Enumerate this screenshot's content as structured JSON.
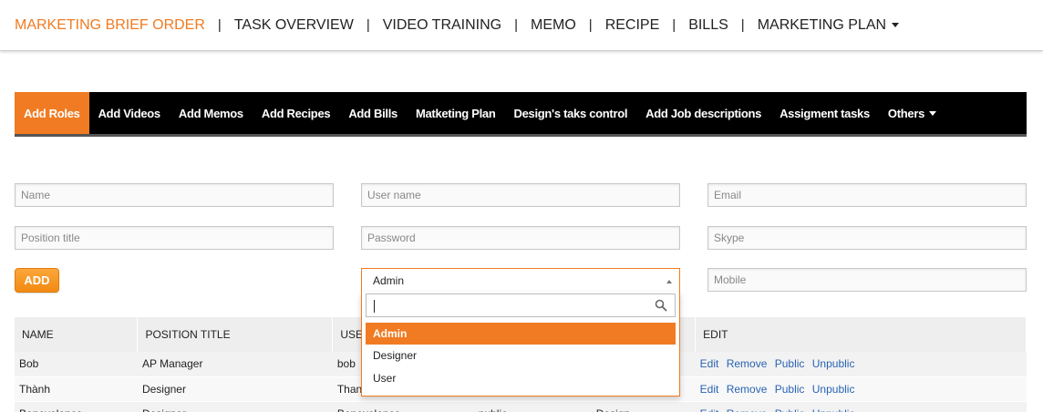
{
  "topnav": {
    "items": [
      "MARKETING BRIEF ORDER",
      "TASK OVERVIEW",
      "VIDEO TRAINING",
      "MEMO",
      "RECIPE",
      "BILLS",
      "MARKETING PLAN"
    ],
    "separator": "|",
    "active": 0
  },
  "subnav": {
    "items": [
      "Add Roles",
      "Add Videos",
      "Add Memos",
      "Add Recipes",
      "Add Bills",
      "Matketing Plan",
      "Design's taks control",
      "Add Job descriptions",
      "Assigment tasks",
      "Others"
    ],
    "active": 0
  },
  "form": {
    "name_placeholder": "Name",
    "username_placeholder": "User name",
    "email_placeholder": "Email",
    "position_placeholder": "Position title",
    "password_placeholder": "Password",
    "skype_placeholder": "Skype",
    "mobile_placeholder": "Mobile",
    "add_label": "ADD"
  },
  "role_select": {
    "selected": "Admin",
    "search_value": "",
    "options": [
      "Admin",
      "Designer",
      "User"
    ],
    "highlighted": 0
  },
  "table": {
    "headers": [
      "NAME",
      "POSITION TITLE",
      "USE",
      "",
      "",
      "EDIT"
    ],
    "rows": [
      {
        "name": "Bob",
        "position": "AP Manager",
        "user": "bob",
        "c4": "",
        "c5": ""
      },
      {
        "name": "Thành",
        "position": "Designer",
        "user": "Than",
        "c4": "",
        "c5": ""
      },
      {
        "name": "Benevolence",
        "position": "Designer",
        "user": "Benevolence",
        "c4": "public",
        "c5": "Design"
      }
    ],
    "actions": [
      "Edit",
      "Remove",
      "Public",
      "Unpublic"
    ]
  },
  "colors": {
    "accent": "#f07b22",
    "link": "#2a63b3",
    "subnav_bg": "#000000"
  }
}
